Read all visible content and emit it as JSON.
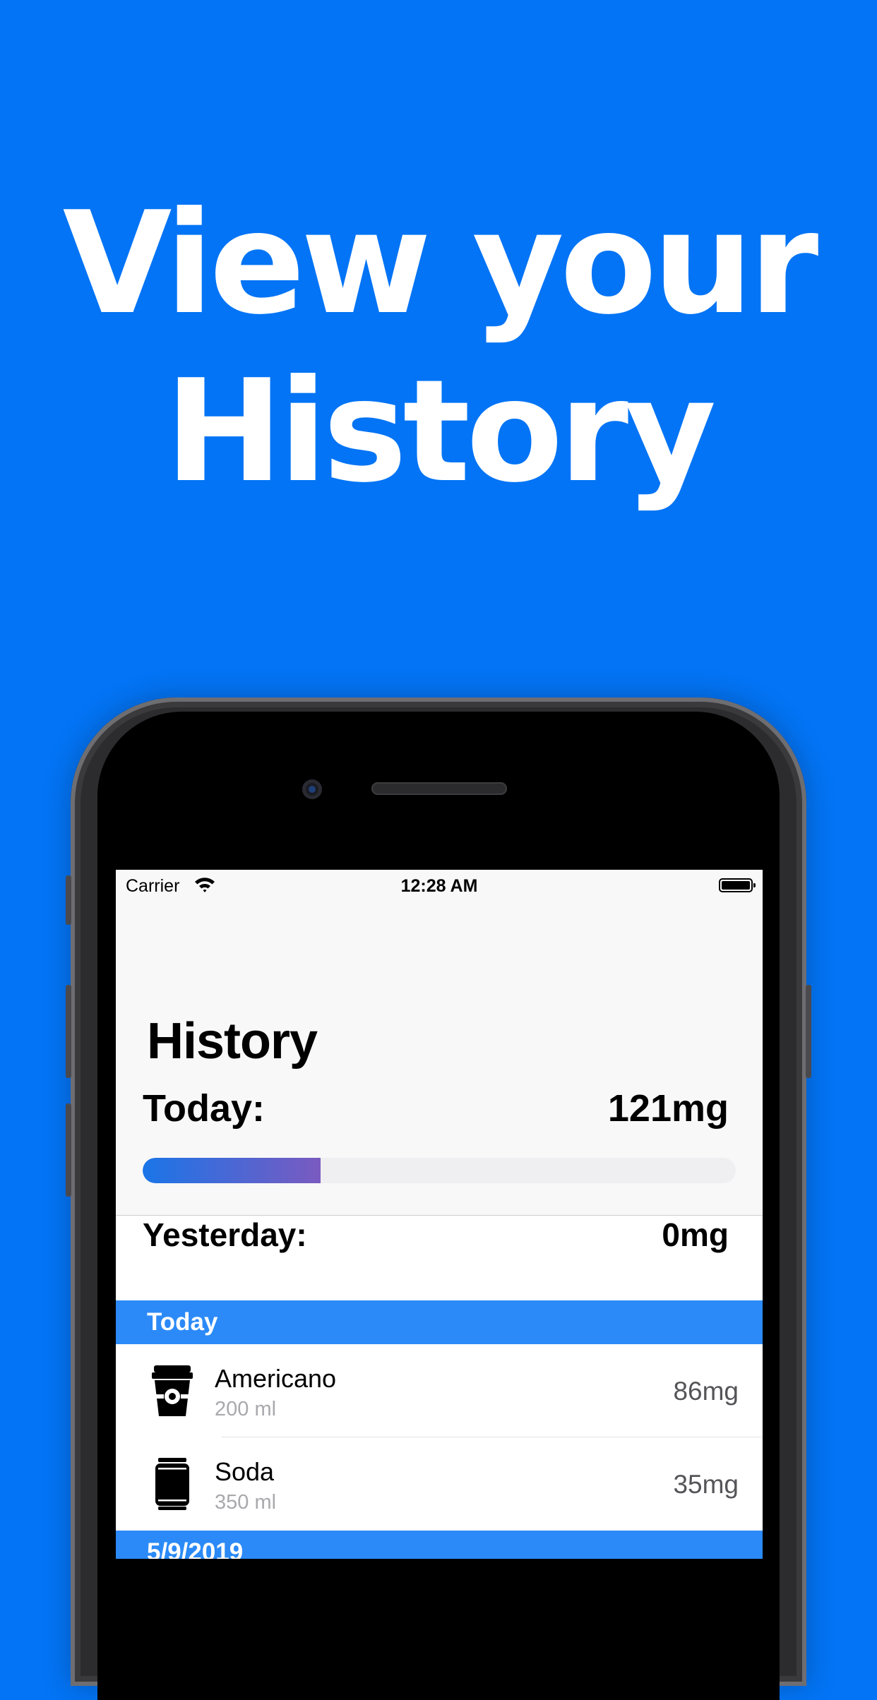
{
  "headline": {
    "line1": "View your",
    "line2": "History"
  },
  "status_bar": {
    "carrier": "Carrier",
    "time": "12:28 AM"
  },
  "nav": {
    "title": "History"
  },
  "summary": {
    "today_label": "Today:",
    "today_value": "121mg",
    "today_progress_percent": 30,
    "yesterday_label": "Yesterday:",
    "yesterday_value": "0mg"
  },
  "sections": [
    {
      "header": "Today",
      "items": [
        {
          "name": "Americano",
          "volume": "200 ml",
          "caffeine": "86mg",
          "icon": "coffee-cup-icon"
        },
        {
          "name": "Soda",
          "volume": "350 ml",
          "caffeine": "35mg",
          "icon": "soda-can-icon"
        }
      ]
    },
    {
      "header": "5/9/2019"
    }
  ],
  "colors": {
    "background": "#0374F5",
    "section_header": "#2B8AF7",
    "progress_start": "#1a75e8",
    "progress_end": "#7a5ac0"
  }
}
